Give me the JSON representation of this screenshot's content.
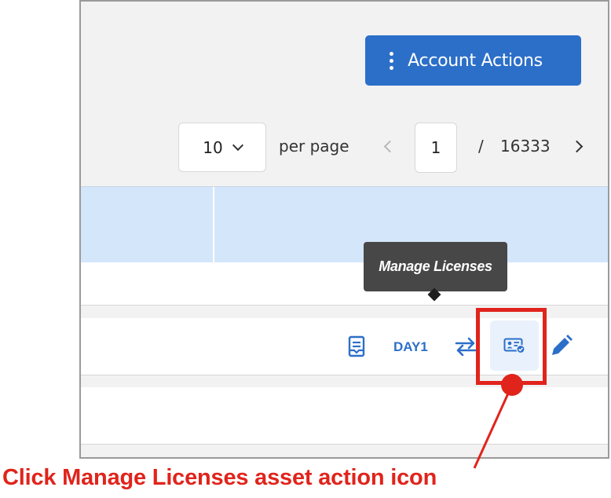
{
  "header": {
    "account_actions_label": "Account Actions"
  },
  "pagination": {
    "per_page_value": "10",
    "per_page_label": "per page",
    "current_page": "1",
    "separator": "/",
    "total_pages": "16333"
  },
  "row_actions": {
    "day1_label": "DAY1"
  },
  "tooltip": {
    "text": "Manage Licenses"
  },
  "annotation": {
    "instruction": "Click Manage Licenses asset action icon",
    "color": "#e0241c"
  },
  "colors": {
    "accent": "#2c6fc9",
    "header_bg": "#d4e6fa",
    "tooltip_bg": "#474747"
  },
  "icons": [
    "kebab-icon",
    "chevron-down-icon",
    "chevron-left-icon",
    "chevron-right-icon",
    "document-icon",
    "swap-arrows-icon",
    "license-card-icon",
    "pencil-icon"
  ]
}
